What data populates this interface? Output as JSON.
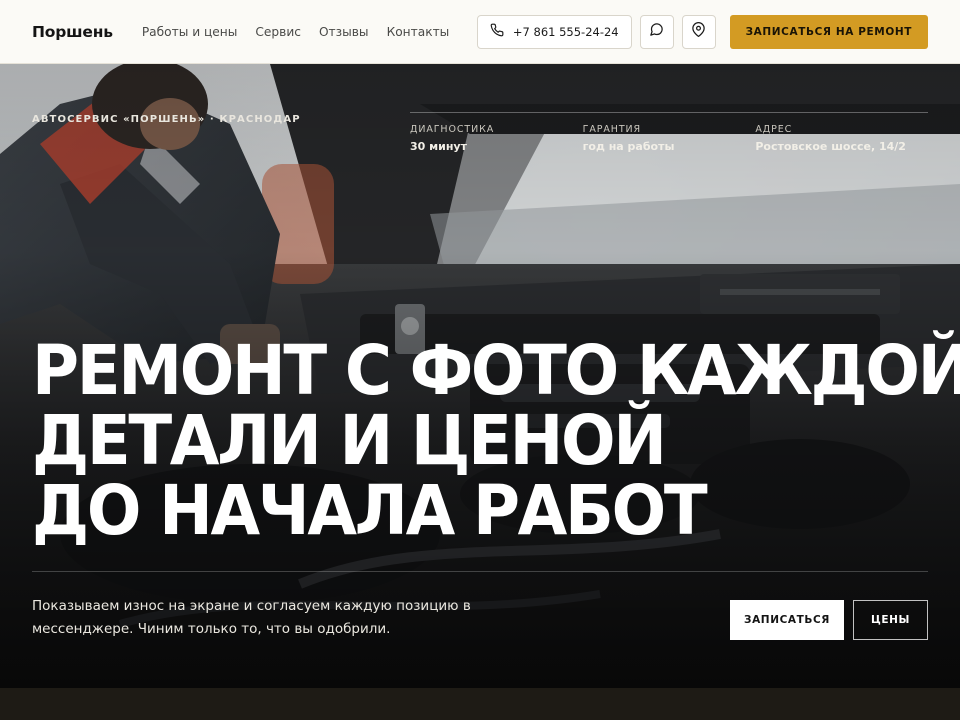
{
  "header": {
    "logo": "Поршень",
    "nav": [
      {
        "label": "Работы и цены"
      },
      {
        "label": "Сервис"
      },
      {
        "label": "Отзывы"
      },
      {
        "label": "Контакты"
      }
    ],
    "phone": "+7 861 555-24-24",
    "phone_icon": "phone-icon",
    "chat_icon": "chat-bubble-icon",
    "location_icon": "map-pin-icon",
    "cta": "ЗАПИСАТЬСЯ НА РЕМОНТ"
  },
  "hero": {
    "eyebrow": "АВТОСЕРВИС «ПОРШЕНЬ» · КРАСНОДАР",
    "facts": [
      {
        "label": "ДИАГНОСТИКА",
        "value": "30 минут"
      },
      {
        "label": "ГАРАНТИЯ",
        "value": "год на работы"
      },
      {
        "label": "АДРЕС",
        "value": "Ростовское шоссе, 14/2"
      }
    ],
    "headline": [
      "РЕМОНТ С ФОТО КАЖДОЙ",
      "ДЕТАЛИ И ЦЕНОЙ",
      "ДО НАЧАЛА РАБОТ"
    ],
    "lead": "Показываем износ на экране и согласуем каждую позицию в мессенджере. Чиним только то, что вы одобрили.",
    "primary_button": "ЗАПИСАТЬСЯ",
    "secondary_button": "ЦЕНЫ",
    "background": "mechanic-engine-bay-photo"
  },
  "colors": {
    "accent": "#d39b23",
    "header_bg": "#fbfaf6",
    "hero_text": "#ffffff"
  }
}
